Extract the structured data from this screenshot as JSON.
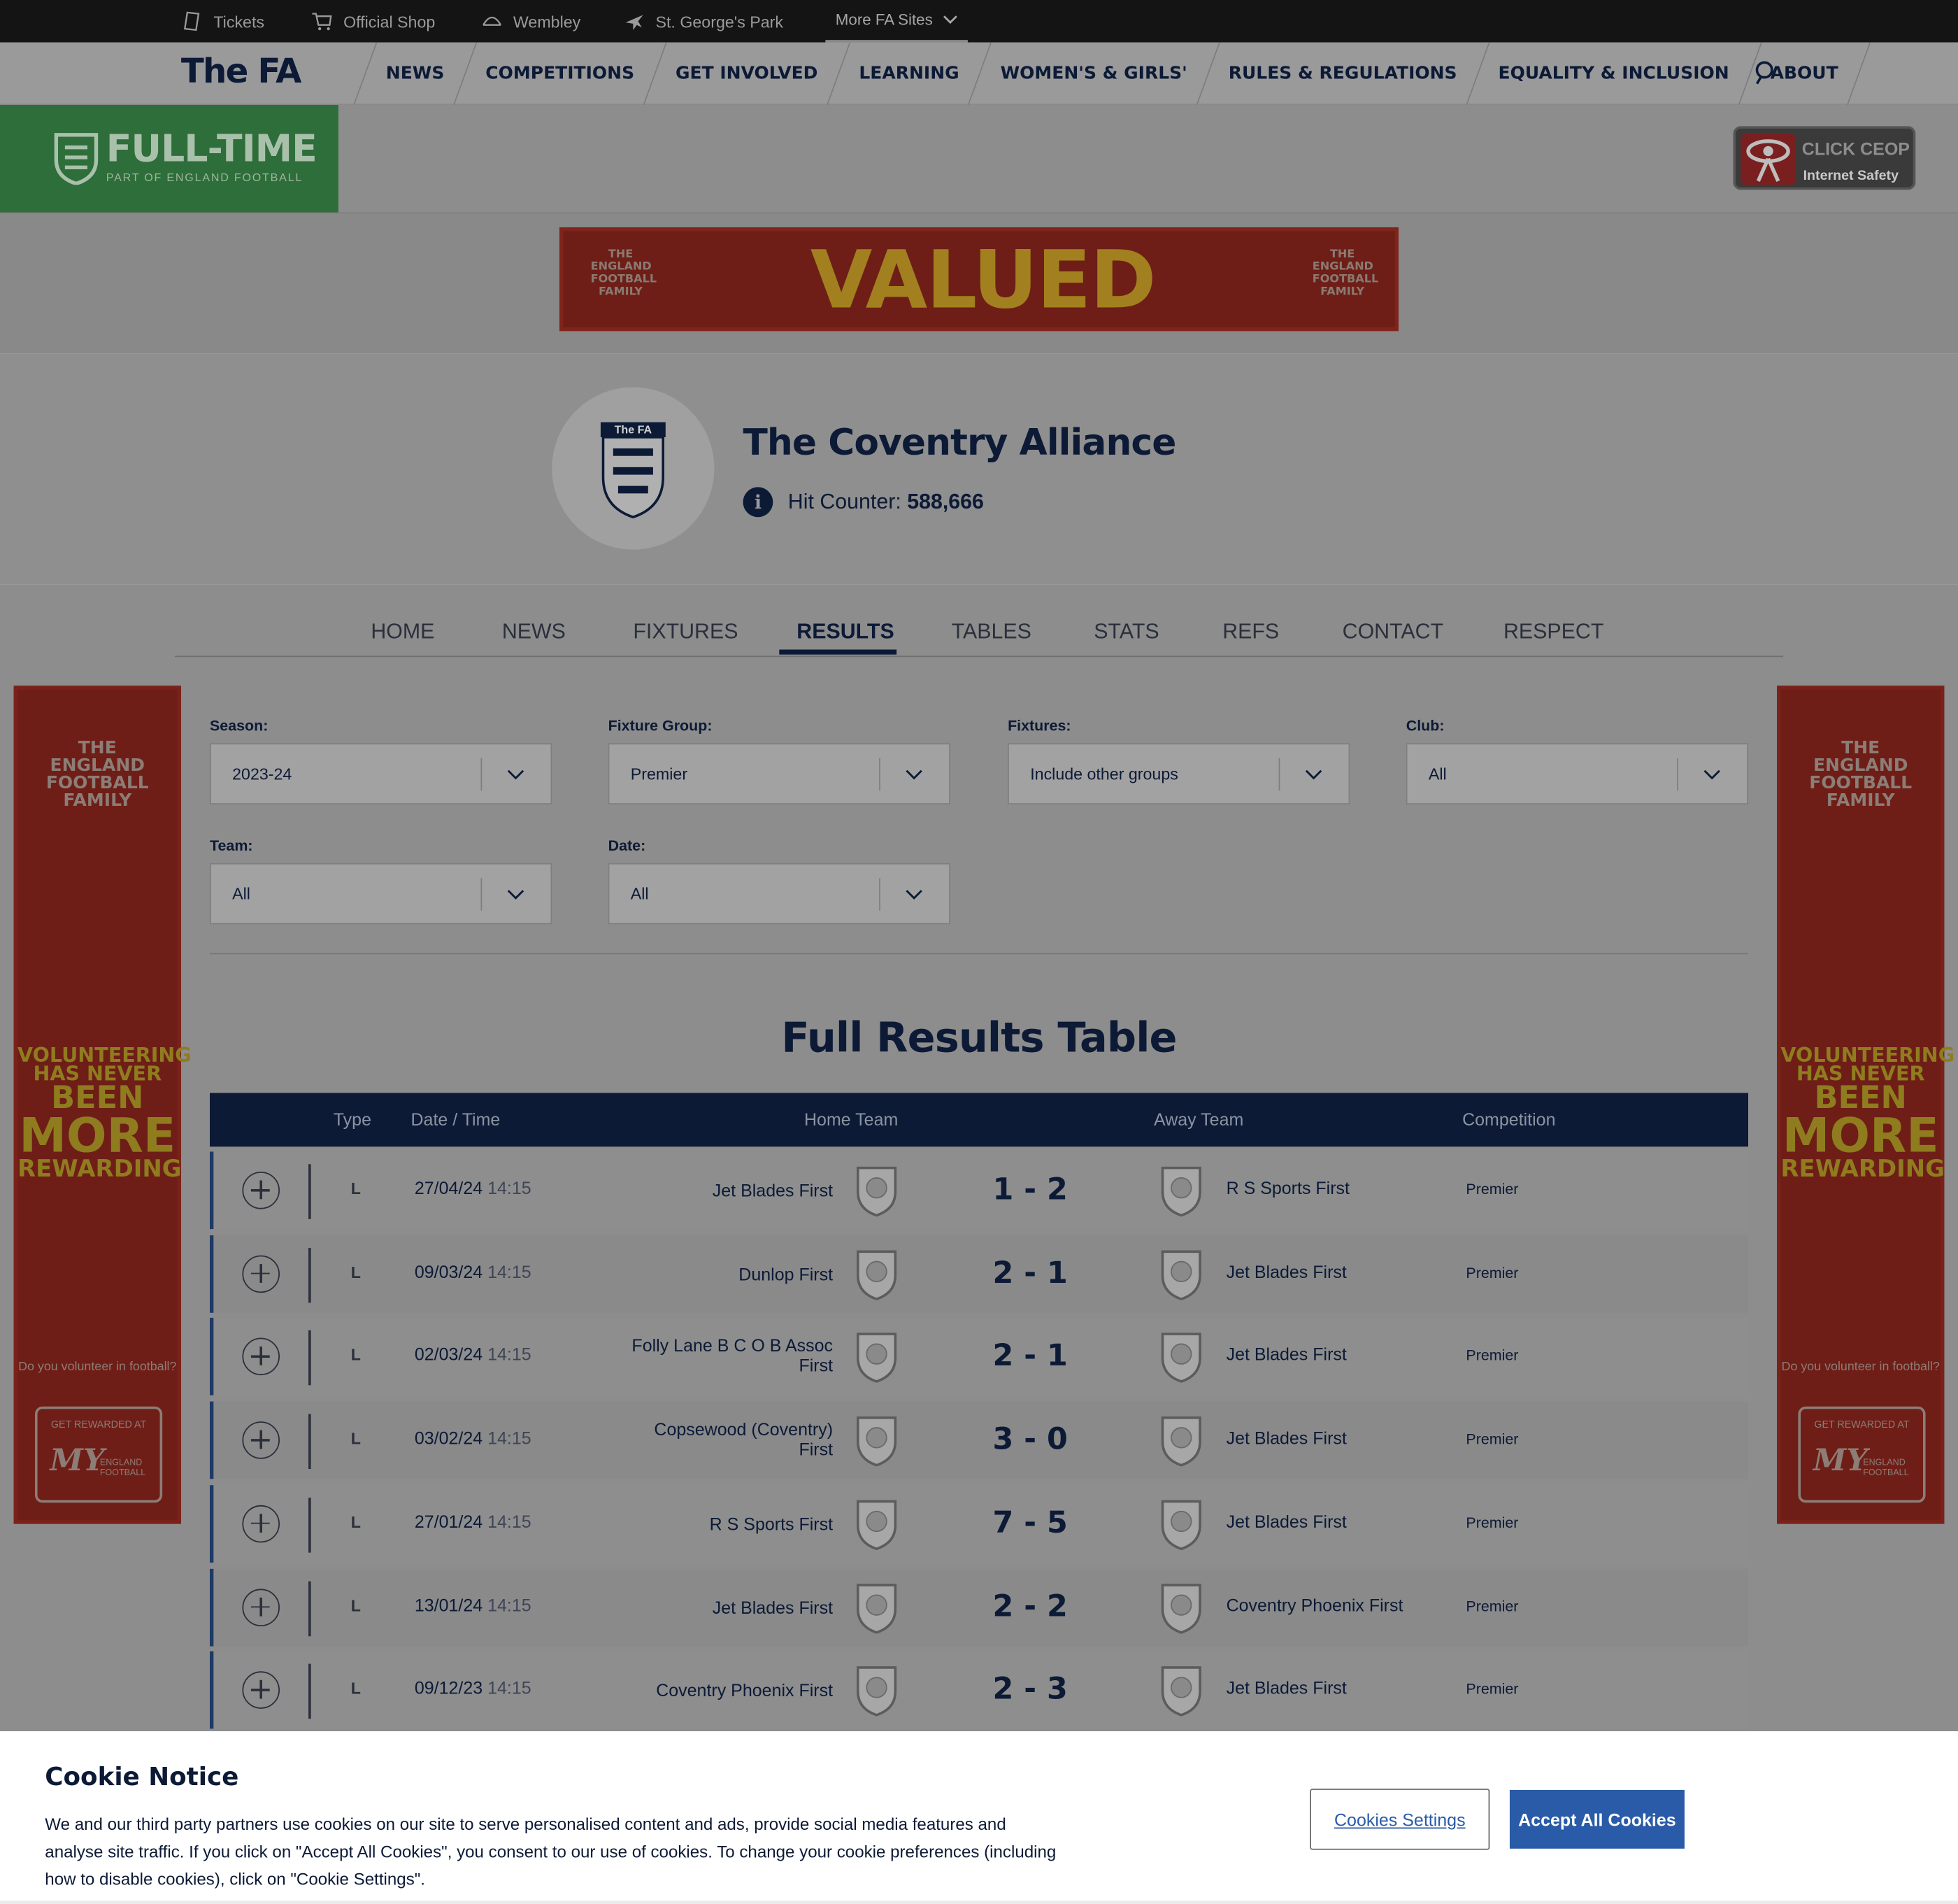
{
  "topbar": {
    "items": [
      {
        "label": "Tickets",
        "icon": "ticket-icon"
      },
      {
        "label": "Official Shop",
        "icon": "cart-icon"
      },
      {
        "label": "Wembley",
        "icon": "arch-icon"
      },
      {
        "label": "St. George's Park",
        "icon": "plane-icon"
      }
    ],
    "more_label": "More FA Sites"
  },
  "mainnav": {
    "logo": "The FA",
    "items": [
      "NEWS",
      "COMPETITIONS",
      "GET INVOLVED",
      "LEARNING",
      "WOMEN'S & GIRLS'",
      "RULES & REGULATIONS",
      "EQUALITY & INCLUSION",
      "ABOUT"
    ]
  },
  "fulltime": {
    "title": "FULL-TIME",
    "subtitle": "PART OF ENGLAND FOOTBALL"
  },
  "ceop": {
    "line1": "CLICK CEOP",
    "line2": "Internet Safety"
  },
  "banner": {
    "word": "VALUED",
    "logo_text": "THE ENGLAND FOOTBALL FAMILY"
  },
  "league": {
    "crest_text": "The FA",
    "title": "The Coventry Alliance",
    "hit_label": "Hit Counter:",
    "hit_value": "588,666"
  },
  "tabs": [
    {
      "label": "HOME",
      "active": false
    },
    {
      "label": "NEWS",
      "active": false
    },
    {
      "label": "FIXTURES",
      "active": false
    },
    {
      "label": "RESULTS",
      "active": true
    },
    {
      "label": "TABLES",
      "active": false
    },
    {
      "label": "STATS",
      "active": false
    },
    {
      "label": "REFS",
      "active": false
    },
    {
      "label": "CONTACT",
      "active": false
    },
    {
      "label": "RESPECT",
      "active": false
    }
  ],
  "sidead": {
    "top": [
      "THE",
      "ENGLAND",
      "FOOTBALL",
      "FAMILY"
    ],
    "mid": [
      "VOLUNTEERING",
      "HAS NEVER",
      "BEEN",
      "MORE",
      "REWARDING"
    ],
    "question": "Do you volunteer in football?",
    "box_label": "GET REWARDED AT",
    "box_my": "MY",
    "box_sub": "ENGLAND FOOTBALL"
  },
  "filters": {
    "season": {
      "label": "Season:",
      "value": "2023-24"
    },
    "fixture_group": {
      "label": "Fixture Group:",
      "value": "Premier"
    },
    "fixtures": {
      "label": "Fixtures:",
      "value": "Include other groups"
    },
    "club": {
      "label": "Club:",
      "value": "All"
    },
    "team": {
      "label": "Team:",
      "value": "All"
    },
    "date": {
      "label": "Date:",
      "value": "All"
    }
  },
  "results": {
    "title": "Full Results Table",
    "columns": [
      "Type",
      "Date / Time",
      "Home Team",
      "Away Team",
      "Competition"
    ],
    "rows": [
      {
        "type": "L",
        "date": "27/04/24",
        "time": "14:15",
        "home": "Jet Blades First",
        "score": "1 - 2",
        "away": "R S Sports First",
        "competition": "Premier"
      },
      {
        "type": "L",
        "date": "09/03/24",
        "time": "14:15",
        "home": "Dunlop First",
        "score": "2 - 1",
        "away": "Jet Blades First",
        "competition": "Premier"
      },
      {
        "type": "L",
        "date": "02/03/24",
        "time": "14:15",
        "home": "Folly Lane B C O B Assoc First",
        "score": "2 - 1",
        "away": "Jet Blades First",
        "competition": "Premier"
      },
      {
        "type": "L",
        "date": "03/02/24",
        "time": "14:15",
        "home": "Copsewood (Coventry) First",
        "score": "3 - 0",
        "away": "Jet Blades First",
        "competition": "Premier"
      },
      {
        "type": "L",
        "date": "27/01/24",
        "time": "14:15",
        "home": "R S Sports First",
        "score": "7 - 5",
        "away": "Jet Blades First",
        "competition": "Premier"
      },
      {
        "type": "L",
        "date": "13/01/24",
        "time": "14:15",
        "home": "Jet Blades First",
        "score": "2 - 2",
        "away": "Coventry Phoenix First",
        "competition": "Premier"
      },
      {
        "type": "L",
        "date": "09/12/23",
        "time": "14:15",
        "home": "Coventry Phoenix First",
        "score": "2 - 3",
        "away": "Jet Blades First",
        "competition": "Premier"
      }
    ]
  },
  "cookie": {
    "title": "Cookie Notice",
    "text": "We and our third party partners use cookies on our site to serve personalised content and ads, provide social media features and analyse site traffic. If you click on \"Accept All Cookies\", you consent to our use of cookies. To change your cookie preferences (including how to disable cookies), click on \"Cookie Settings\".",
    "settings_label": "Cookies Settings",
    "accept_label": "Accept All Cookies"
  }
}
